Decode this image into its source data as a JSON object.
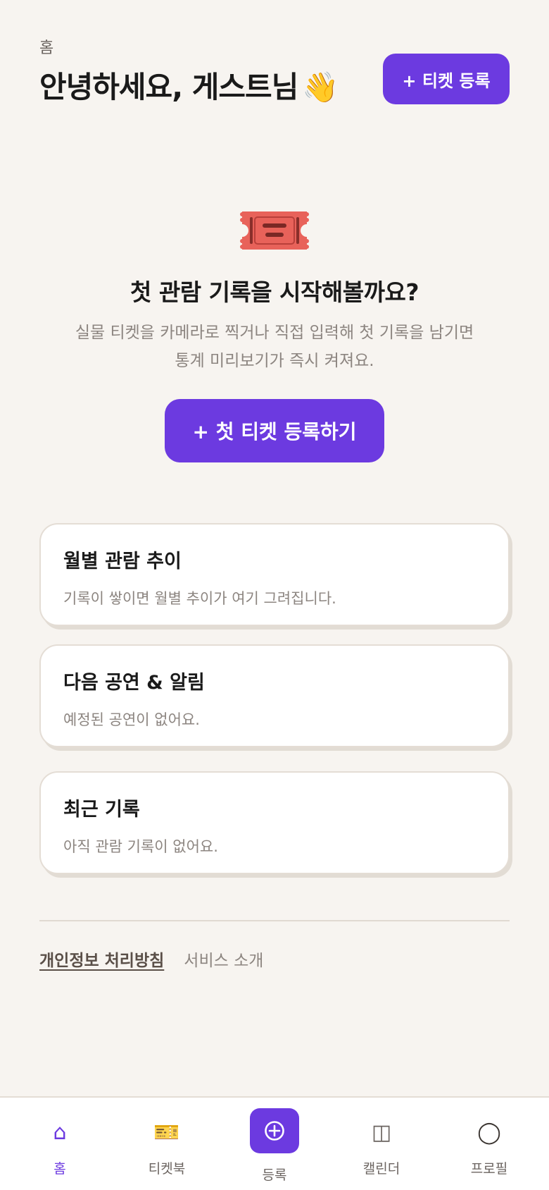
{
  "header": {
    "breadcrumb": "홈",
    "greeting": "안녕하세요, 게스트님",
    "greeting_emoji": "👋",
    "register_button": "+ 티켓 등록"
  },
  "empty_state": {
    "icon": "ticket-icon",
    "title": "첫 관람 기록을 시작해볼까요?",
    "description": "실물 티켓을 카메라로 찍거나 직접 입력해 첫 기록을 남기면 통계 미리보기가 즉시 켜져요.",
    "button": "+ 첫 티켓 등록하기"
  },
  "cards": [
    {
      "title": "월별 관람 추이",
      "description": "기록이 쌓이면 월별 추이가 여기 그려집니다."
    },
    {
      "title": "다음 공연 & 알림",
      "description": "예정된 공연이 없어요."
    },
    {
      "title": "최근 기록",
      "description": "아직 관람 기록이 없어요."
    }
  ],
  "footer": {
    "privacy_link": "개인정보 처리방침",
    "about_link": "서비스 소개"
  },
  "bottom_nav": [
    {
      "label": "홈",
      "icon": "home-icon",
      "glyph": "⌂",
      "active": true
    },
    {
      "label": "티켓북",
      "icon": "ticket-book-icon",
      "glyph": "🎫",
      "active": false
    },
    {
      "label": "등록",
      "icon": "plus-circle-icon",
      "glyph": "",
      "active": false
    },
    {
      "label": "캘린더",
      "icon": "calendar-icon",
      "glyph": "◫",
      "active": false
    },
    {
      "label": "프로필",
      "icon": "profile-icon",
      "glyph": "◯",
      "active": false
    }
  ],
  "colors": {
    "accent": "#6c3ae0",
    "background": "#f7f4f0",
    "ticket_red": "#e8625a"
  }
}
